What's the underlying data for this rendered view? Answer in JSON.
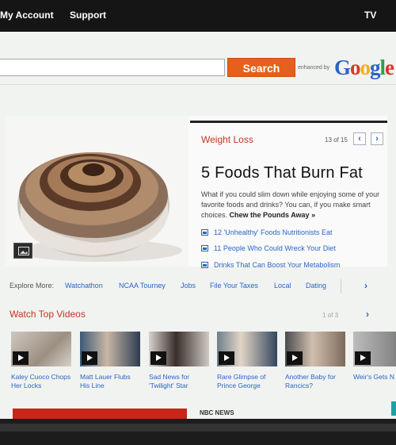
{
  "topbar": {
    "my_account": "My Account",
    "support": "Support",
    "tv": "TV"
  },
  "search": {
    "placeholder": "",
    "button_label": "Search",
    "enhanced_by": "enhanced by",
    "brand": "Google"
  },
  "hero": {
    "category": "Weight Loss",
    "counter": "13 of 15",
    "headline": "5 Foods That Burn Fat",
    "blurb": "What if you could slim down while enjoying some of your favorite foods and drinks? You can, if you make smart choices.",
    "cta": "Chew the Pounds Away »",
    "related": [
      "12 'Unhealthy' Foods Nutritionists Eat",
      "11 People Who Could Wreck Your Diet",
      "Drinks That Can Boost Your Metabolism"
    ]
  },
  "explore": {
    "label": "Explore More:",
    "links": [
      "Watchathon",
      "NCAA Tourney",
      "Jobs",
      "File Your Taxes",
      "Local",
      "Dating"
    ]
  },
  "videos": {
    "heading": "Watch Top Videos",
    "count": "1 of 3",
    "items": [
      {
        "title": "Kaley Cuoco Chops Her Locks"
      },
      {
        "title": "Matt Lauer Flubs His Line"
      },
      {
        "title": "Sad News for 'Twilight' Star"
      },
      {
        "title": "Rare Glimpse of Prince George"
      },
      {
        "title": "Another Baby for Rancics?"
      },
      {
        "title": "Weir's Gets N"
      }
    ]
  },
  "footer": {
    "nbc_news": "NBC NEWS"
  },
  "colors": {
    "accent_red": "#c8341f",
    "link_blue": "#2a64c8",
    "search_orange": "#e5601d"
  }
}
